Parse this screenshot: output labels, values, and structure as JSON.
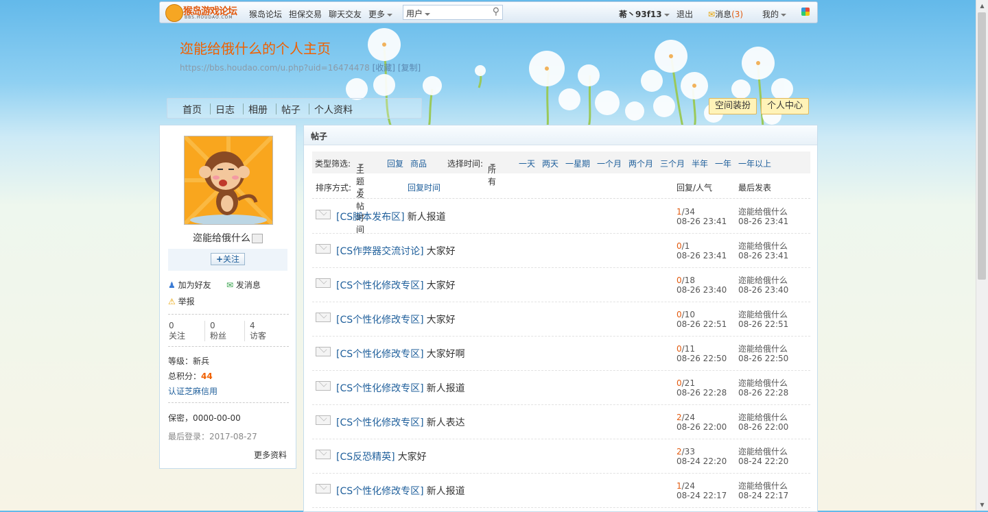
{
  "topbar": {
    "logo_text": "猴岛游戏论坛",
    "logo_sub": "BBS.HOUDAO.COM",
    "nav": [
      "猴岛论坛",
      "担保交易",
      "聊天交友",
      "更多"
    ],
    "search_scope": "用户",
    "search_placeholder": "",
    "user": "莃丶93f13",
    "logout": "退出",
    "messages_label": "消息",
    "messages_count": "(3)",
    "mine": "我的"
  },
  "header": {
    "title": "迩能给俄什么的个人主页",
    "url": "https://bbs.houdao.com/u.php?uid=16474478",
    "bookmark": "[收藏]",
    "copy": "[复制]",
    "tabs": [
      "首页",
      "日志",
      "相册",
      "帖子",
      "个人资料"
    ],
    "btn_decorate": "空间装扮",
    "btn_center": "个人中心"
  },
  "profile": {
    "name": "迩能给俄什么",
    "follow_btn": "关注",
    "add_friend": "加为好友",
    "send_msg": "发消息",
    "report": "举报",
    "stats": [
      {
        "num": "0",
        "label": "关注"
      },
      {
        "num": "0",
        "label": "粉丝"
      },
      {
        "num": "4",
        "label": "访客"
      }
    ],
    "level_label": "等级：",
    "level_value": "新兵",
    "points_label": "总积分：",
    "points_value": "44",
    "zhima": "认证芝麻信用",
    "birthday": "保密，0000-00-00",
    "last_login": "最后登录：2017-08-27",
    "more": "更多资料"
  },
  "posts": {
    "panel_title": "帖子",
    "filter": {
      "type_label": "类型筛选:",
      "type_selected": "主题",
      "type_options": [
        "回复",
        "商品"
      ],
      "time_label": "选择时间:",
      "time_selected": "所有",
      "time_options": [
        "一天",
        "两天",
        "一星期",
        "一个月",
        "两个月",
        "三个月",
        "半年",
        "一年",
        "一年以上"
      ]
    },
    "sort": {
      "label": "排序方式:",
      "selected": "发帖时间",
      "other": "回复时间",
      "col_replies": "回复/人气",
      "col_last": "最后发表"
    },
    "rows": [
      {
        "forum": "[CS脚本发布区]",
        "title": "新人报道",
        "replies": "1",
        "views": "/34",
        "time": "08-26 23:41",
        "last_user": "迩能给俄什么",
        "last_time": "08-26 23:41"
      },
      {
        "forum": "[CS作弊器交流讨论]",
        "title": "大家好",
        "replies": "0",
        "views": "/1",
        "time": "08-26 23:41",
        "last_user": "迩能给俄什么",
        "last_time": "08-26 23:41"
      },
      {
        "forum": "[CS个性化修改专区]",
        "title": "大家好",
        "replies": "0",
        "views": "/18",
        "time": "08-26 23:40",
        "last_user": "迩能给俄什么",
        "last_time": "08-26 23:40"
      },
      {
        "forum": "[CS个性化修改专区]",
        "title": "大家好",
        "replies": "0",
        "views": "/10",
        "time": "08-26 22:51",
        "last_user": "迩能给俄什么",
        "last_time": "08-26 22:51"
      },
      {
        "forum": "[CS个性化修改专区]",
        "title": "大家好啊",
        "replies": "0",
        "views": "/11",
        "time": "08-26 22:50",
        "last_user": "迩能给俄什么",
        "last_time": "08-26 22:50"
      },
      {
        "forum": "[CS个性化修改专区]",
        "title": "新人报道",
        "replies": "0",
        "views": "/21",
        "time": "08-26 22:28",
        "last_user": "迩能给俄什么",
        "last_time": "08-26 22:28"
      },
      {
        "forum": "[CS个性化修改专区]",
        "title": "新人表达",
        "replies": "2",
        "views": "/24",
        "time": "08-26 22:00",
        "last_user": "迩能给俄什么",
        "last_time": "08-26 22:00"
      },
      {
        "forum": "[CS反恐精英]",
        "title": "大家好",
        "replies": "2",
        "views": "/33",
        "time": "08-24 22:20",
        "last_user": "迩能给俄什么",
        "last_time": "08-24 22:20"
      },
      {
        "forum": "[CS个性化修改专区]",
        "title": "新人报道",
        "replies": "1",
        "views": "/24",
        "time": "08-24 22:17",
        "last_user": "迩能给俄什么",
        "last_time": "08-24 22:17"
      }
    ]
  },
  "colors": {
    "accent": "#f06000",
    "link": "#1f5f9b",
    "reply_count": "#e25a0f"
  }
}
